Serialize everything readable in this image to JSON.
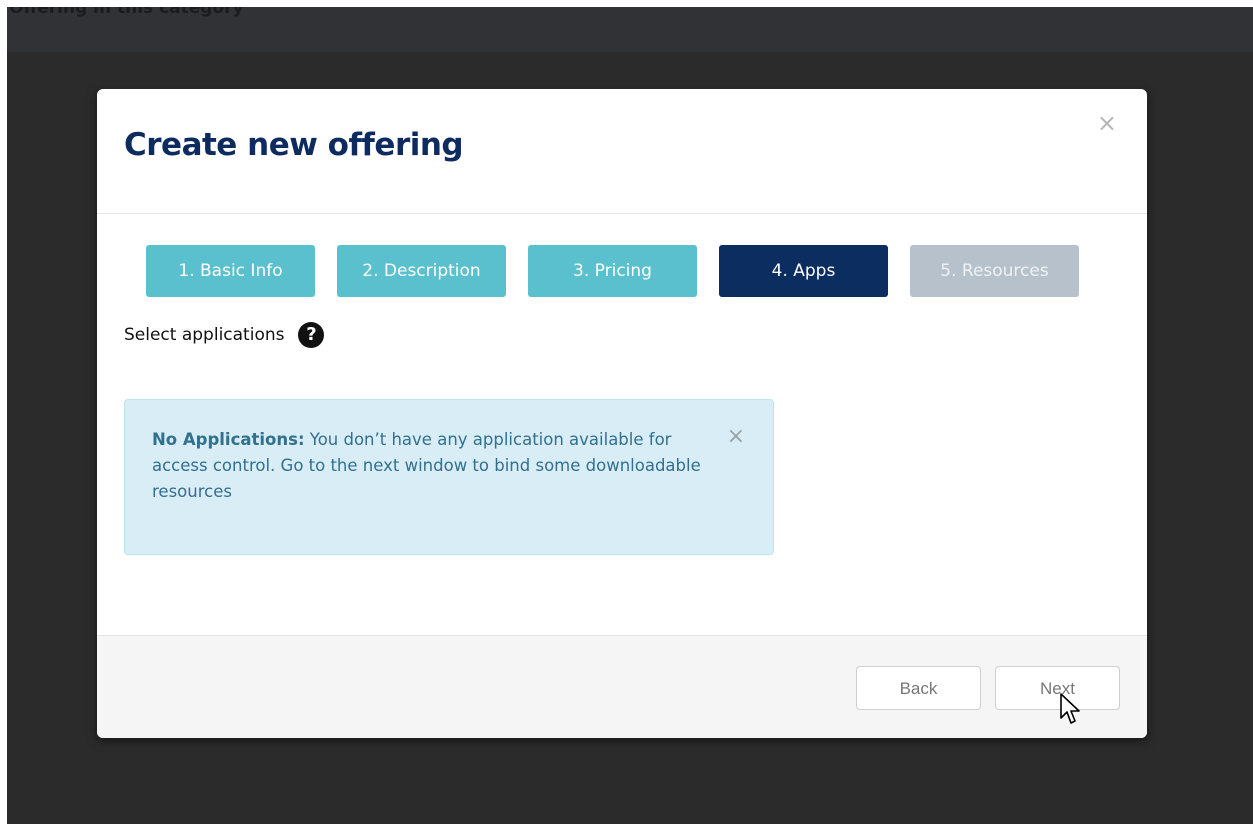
{
  "background": {
    "top_bar_text": "Offering in this category"
  },
  "modal": {
    "title": "Create new offering",
    "close_icon": "×"
  },
  "steps": [
    {
      "label": "1. Basic Info",
      "state": "done"
    },
    {
      "label": "2. Description",
      "state": "done"
    },
    {
      "label": "3. Pricing",
      "state": "done"
    },
    {
      "label": "4. Apps",
      "state": "active"
    },
    {
      "label": "5. Resources",
      "state": "disabled"
    }
  ],
  "apps": {
    "label": "Select applications",
    "help_icon": "?"
  },
  "alert": {
    "title": "No Applications:",
    "message": " You don’t have any application available for access control. Go to the next window to bind some downloadable resources",
    "close_icon": "×"
  },
  "footer": {
    "back_label": "Back",
    "next_label": "Next"
  },
  "colors": {
    "step_done": "#5bc0cd",
    "step_active": "#0b2d60",
    "step_disabled": "#b6c1cc",
    "title": "#0d2b5e",
    "alert_bg": "#d9edf6",
    "alert_text": "#31708f"
  }
}
